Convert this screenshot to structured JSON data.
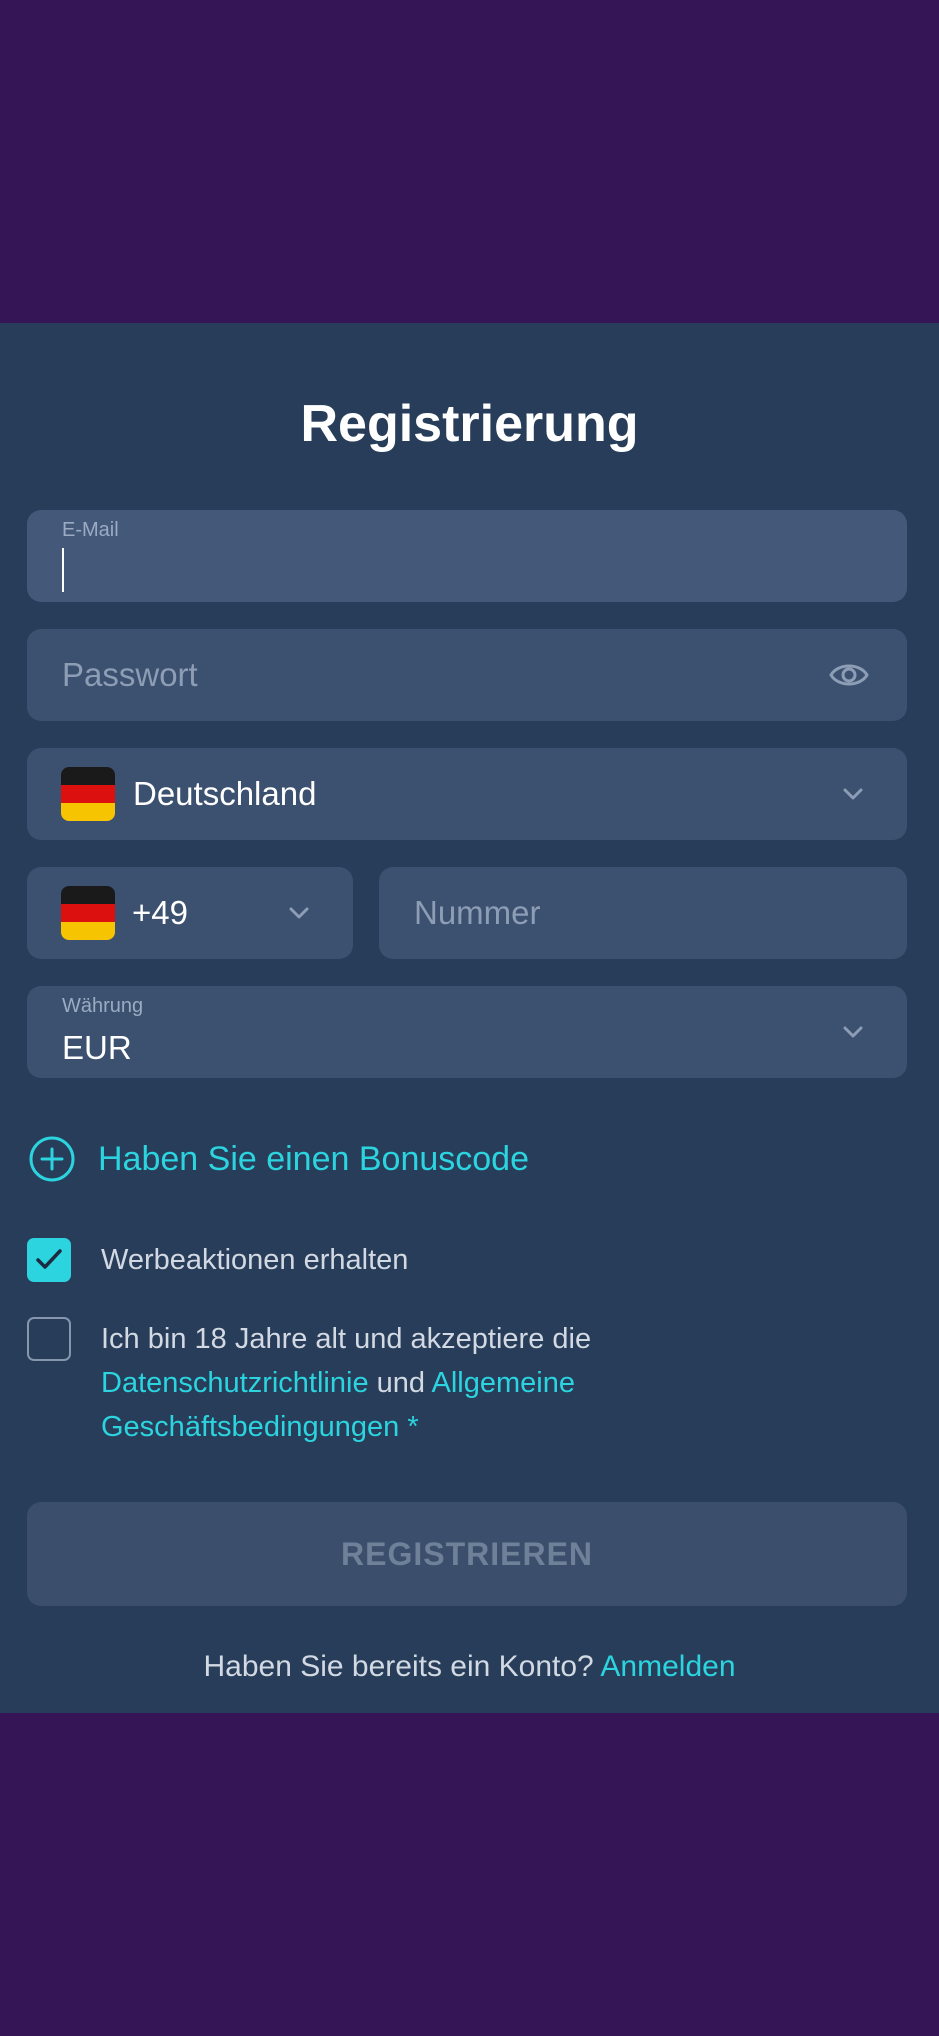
{
  "form": {
    "title": "Registrierung",
    "email": {
      "label": "E-Mail",
      "value": ""
    },
    "password": {
      "placeholder": "Passwort",
      "icon": "eye-icon"
    },
    "country": {
      "value": "Deutschland",
      "flag": "germany-flag-icon"
    },
    "phone_code": {
      "value": "+49",
      "flag": "germany-flag-icon"
    },
    "phone_number": {
      "placeholder": "Nummer"
    },
    "currency": {
      "label": "Währung",
      "value": "EUR"
    },
    "bonus": {
      "label": "Haben Sie einen Bonuscode",
      "icon": "plus-circle-icon"
    },
    "promotions": {
      "label": "Werbeaktionen erhalten",
      "checked": true
    },
    "terms": {
      "line1": "Ich bin 18 Jahre alt und akzeptiere die",
      "privacy_link": "Datenschutzrichtlinie",
      "and": "und",
      "terms_link_1": "Allgemeine",
      "terms_link_2": "Geschäftsbedingungen",
      "required": "*",
      "checked": false
    },
    "submit_label": "REGISTRIEREN",
    "footer": {
      "question": "Haben Sie bereits ein Konto?",
      "login_link": "Anmelden"
    }
  },
  "colors": {
    "background": "#361556",
    "panel": "#283d59",
    "field": "#3c5170",
    "accent": "#2bd4df"
  }
}
